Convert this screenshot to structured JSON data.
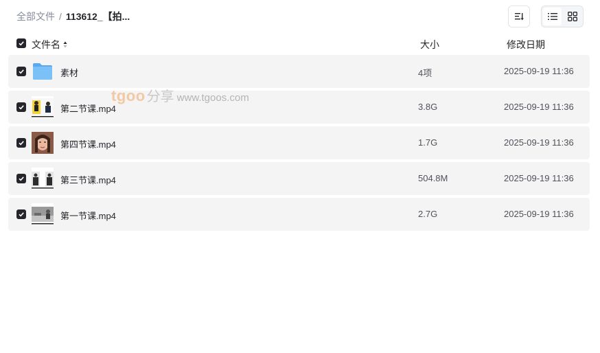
{
  "breadcrumb": {
    "root": "全部文件",
    "separator": "/",
    "current": "113612_【拍..."
  },
  "toolbar": {
    "sort_icon": "sort-icon",
    "view_list_icon": "list-view-icon",
    "view_grid_icon": "grid-view-icon"
  },
  "header": {
    "name": "文件名",
    "size": "大小",
    "date": "修改日期"
  },
  "files": [
    {
      "name": "素材",
      "size": "4项",
      "date": "2025-09-19 11:36",
      "type": "folder"
    },
    {
      "name": "第二节课.mp4",
      "size": "3.8G",
      "date": "2025-09-19 11:36",
      "type": "video"
    },
    {
      "name": "第四节课.mp4",
      "size": "1.7G",
      "date": "2025-09-19 11:36",
      "type": "video"
    },
    {
      "name": "第三节课.mp4",
      "size": "504.8M",
      "date": "2025-09-19 11:36",
      "type": "video"
    },
    {
      "name": "第一节课.mp4",
      "size": "2.7G",
      "date": "2025-09-19 11:36",
      "type": "video"
    }
  ],
  "watermark": {
    "brand": "tgoo",
    "share": "分享",
    "url": "www.tgoos.com"
  },
  "colors": {
    "accent": "#25262b",
    "row_bg": "#f4f4f5",
    "folder": "#6cb4f5"
  }
}
